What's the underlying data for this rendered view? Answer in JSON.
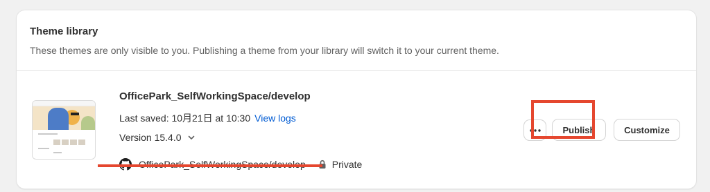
{
  "library": {
    "title": "Theme library",
    "description": "These themes are only visible to you. Publishing a theme from your library will switch it to your current theme."
  },
  "theme": {
    "name": "OfficePark_SelfWorkingSpace/develop",
    "last_saved_label": "Last saved: 10月21日 at 10:30",
    "view_logs_label": "View logs",
    "version_label": "Version 15.4.0",
    "repo_name": "OfficePark_SelfWorkingSpace/develop",
    "visibility": "Private"
  },
  "actions": {
    "more_icon": "ellipsis-icon",
    "publish_label": "Publish",
    "customize_label": "Customize"
  },
  "colors": {
    "link": "#005bd3",
    "annotation": "#e5472f"
  }
}
